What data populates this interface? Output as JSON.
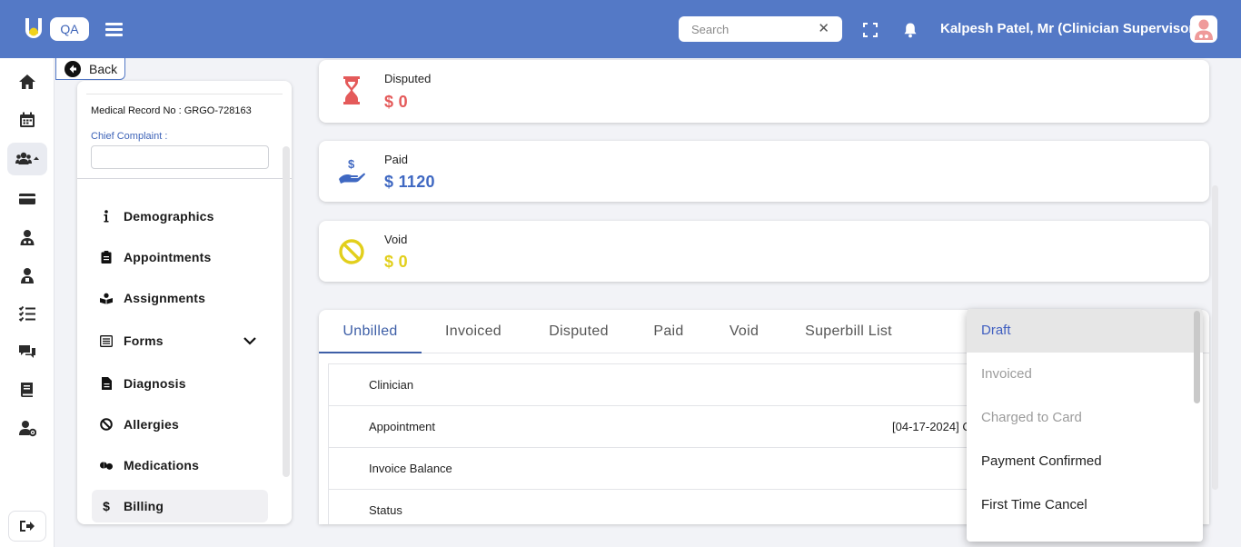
{
  "header": {
    "env_badge": "QA",
    "search_placeholder": "Search",
    "search_clear": "✕",
    "user_name": "Kalpesh Patel, Mr (Clinician Supervisor)"
  },
  "back_label": "Back",
  "patient": {
    "mrn": "Medical Record No : GRGO-728163",
    "chief_complaint_label": "Chief Complaint :",
    "chief_complaint_value": ""
  },
  "nav": [
    {
      "label": "Demographics",
      "icon": "info-icon"
    },
    {
      "label": "Appointments",
      "icon": "clipboard-icon"
    },
    {
      "label": "Assignments",
      "icon": "book-user-icon"
    },
    {
      "label": "Forms",
      "icon": "form-list-icon"
    },
    {
      "label": "Diagnosis",
      "icon": "file-icon"
    },
    {
      "label": "Allergies",
      "icon": "ban-icon"
    },
    {
      "label": "Medications",
      "icon": "pills-icon"
    },
    {
      "label": "Billing",
      "icon": "dollar-icon"
    }
  ],
  "stats": {
    "disputed": {
      "label": "Disputed",
      "value": "$ 0",
      "color": "#e45a5a"
    },
    "paid": {
      "label": "Paid",
      "value": "$ 1120",
      "color": "#3f68c2"
    },
    "void": {
      "label": "Void",
      "value": "$ 0",
      "color": "#e2cf1c"
    }
  },
  "tabs": [
    "Unbilled",
    "Invoiced",
    "Disputed",
    "Paid",
    "Void",
    "Superbill List"
  ],
  "details": [
    {
      "label": "Clinician",
      "value": ""
    },
    {
      "label": "Appointment",
      "value": "[04-17-2024] C"
    },
    {
      "label": "Invoice Balance",
      "value": ""
    },
    {
      "label": "Status",
      "value": ""
    }
  ],
  "status_dropdown": {
    "options": [
      {
        "label": "Draft",
        "state": "selected"
      },
      {
        "label": "Invoiced",
        "state": "disabled"
      },
      {
        "label": "Charged to Card",
        "state": "disabled"
      },
      {
        "label": "Payment Confirmed",
        "state": "normal"
      },
      {
        "label": "First Time Cancel",
        "state": "normal"
      }
    ]
  },
  "colors": {
    "header_bg": "#5479c6",
    "accent": "#3e5fa7",
    "disputed": "#e45a5a",
    "paid": "#3f68c2",
    "void": "#e2cf1c"
  }
}
